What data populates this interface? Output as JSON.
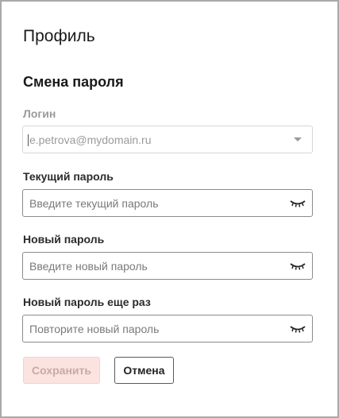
{
  "dialog": {
    "title": "Профиль",
    "section_title": "Смена пароля"
  },
  "login": {
    "label": "Логин",
    "value": "e.petrova@mydomain.ru",
    "icon": "chevron-down-icon"
  },
  "current_password": {
    "label": "Текущий пароль",
    "placeholder": "Введите текущий пароль",
    "icon": "eye-closed-icon"
  },
  "new_password": {
    "label": "Новый пароль",
    "placeholder": "Введите новый пароль",
    "icon": "eye-closed-icon"
  },
  "repeat_password": {
    "label": "Новый пароль еще раз",
    "placeholder": "Повторите новый пароль",
    "icon": "eye-closed-icon"
  },
  "buttons": {
    "save_label": "Сохранить",
    "cancel_label": "Отмена"
  },
  "colors": {
    "save_bg": "#fbe3e0",
    "save_text": "#c9a9a6",
    "border": "#8c8c8c"
  }
}
